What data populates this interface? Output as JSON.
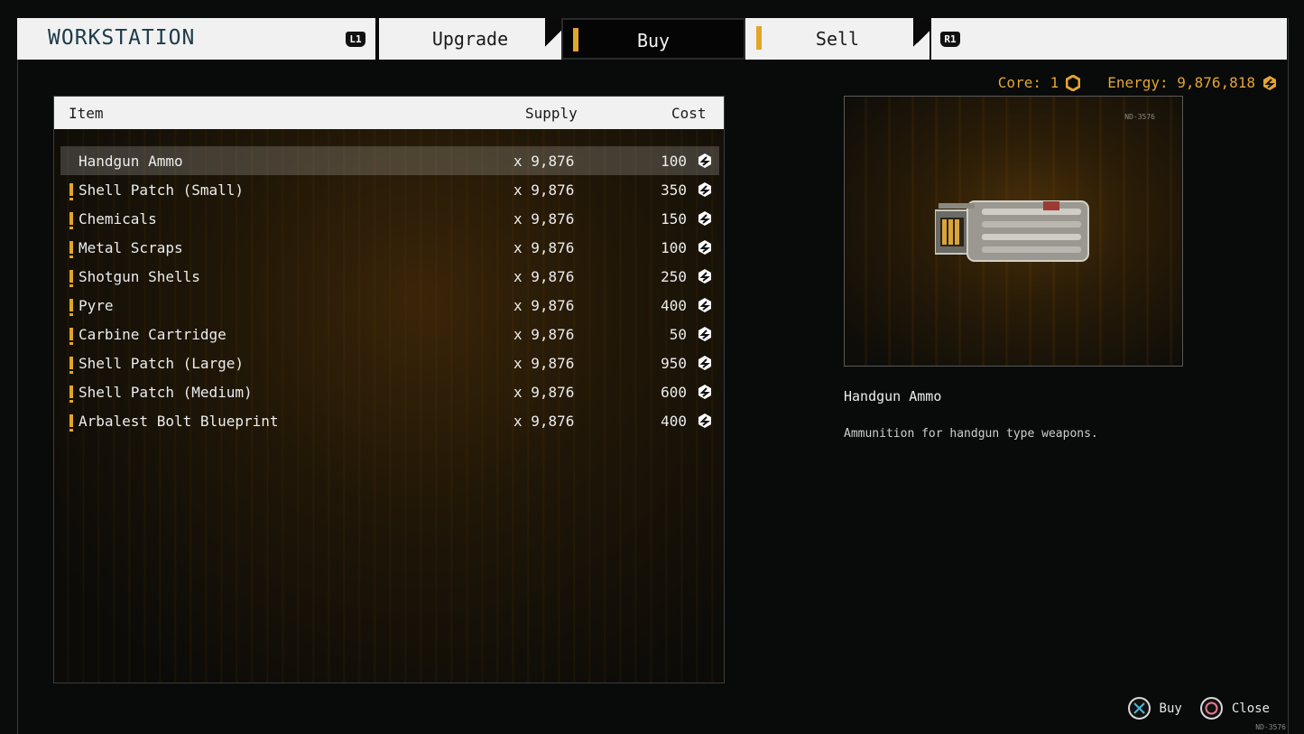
{
  "header": {
    "title": "WORKSTATION",
    "left_shoulder": "L1",
    "right_shoulder": "R1",
    "tabs": [
      {
        "label": "Upgrade",
        "alert": false
      },
      {
        "label": "Buy",
        "alert": true
      },
      {
        "label": "Sell",
        "alert": true
      }
    ],
    "active_tab": "Buy"
  },
  "currency": {
    "core_label": "Core: 1",
    "energy_label": "Energy: 9,876,818"
  },
  "table": {
    "columns": {
      "item": "Item",
      "supply": "Supply",
      "cost": "Cost"
    },
    "rows": [
      {
        "name": "Handgun Ammo",
        "supply": "x 9,876",
        "cost": "100",
        "alert": false,
        "selected": true
      },
      {
        "name": "Shell Patch (Small)",
        "supply": "x 9,876",
        "cost": "350",
        "alert": true,
        "selected": false
      },
      {
        "name": "Chemicals",
        "supply": "x 9,876",
        "cost": "150",
        "alert": true,
        "selected": false
      },
      {
        "name": "Metal Scraps",
        "supply": "x 9,876",
        "cost": "100",
        "alert": true,
        "selected": false
      },
      {
        "name": "Shotgun Shells",
        "supply": "x 9,876",
        "cost": "250",
        "alert": true,
        "selected": false
      },
      {
        "name": "Pyre",
        "supply": "x 9,876",
        "cost": "400",
        "alert": true,
        "selected": false
      },
      {
        "name": "Carbine Cartridge",
        "supply": "x 9,876",
        "cost": "50",
        "alert": true,
        "selected": false
      },
      {
        "name": "Shell Patch (Large)",
        "supply": "x 9,876",
        "cost": "950",
        "alert": true,
        "selected": false
      },
      {
        "name": "Shell Patch (Medium)",
        "supply": "x 9,876",
        "cost": "600",
        "alert": true,
        "selected": false
      },
      {
        "name": "Arbalest Bolt Blueprint",
        "supply": "x 9,876",
        "cost": "400",
        "alert": true,
        "selected": false
      }
    ]
  },
  "detail": {
    "code": "ND-3576",
    "name": "Handgun Ammo",
    "description": "Ammunition for handgun type weapons."
  },
  "footer": {
    "buy_label": "Buy",
    "close_label": "Close",
    "build_code": "ND-3576"
  },
  "colors": {
    "accent": "#e2a52a",
    "currency": "#e3a533",
    "cross_button": "#4fb7d9",
    "circle_button": "#e57a8a"
  }
}
